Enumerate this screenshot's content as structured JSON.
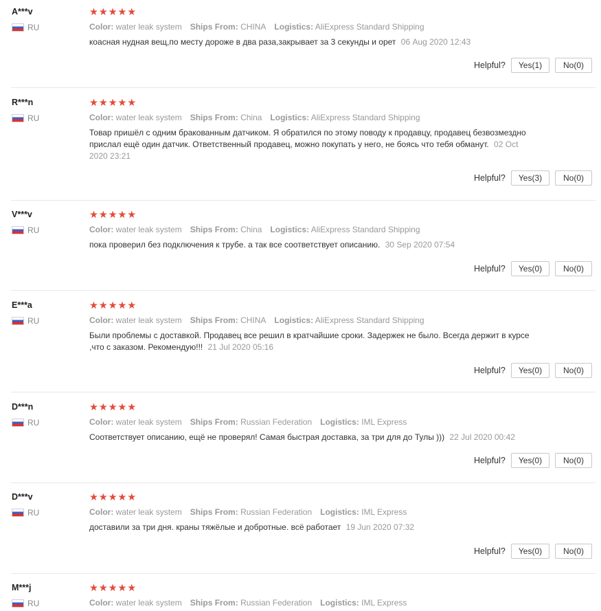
{
  "labels": {
    "color": "Color:",
    "ships_from": "Ships From:",
    "logistics": "Logistics:",
    "helpful": "Helpful?",
    "yes": "Yes",
    "no": "No",
    "stars": "★★★★★"
  },
  "colors": {
    "star": "#e34b3b",
    "meta_gray": "#999999",
    "flag_ru": [
      "#ffffff",
      "#3a5fc8",
      "#e0312b"
    ]
  },
  "reviews": [
    {
      "user": "A***v",
      "country": "RU",
      "rating": 5,
      "color": "water leak system",
      "ships_from": "CHINA",
      "logistics": "AliExpress Standard Shipping",
      "content": "коасная нудная вещ,по месту дороже в два раза,закрывает за 3 секунды и орет",
      "date": "06 Aug 2020 12:43",
      "yes_count": "(1)",
      "no_count": "(0)"
    },
    {
      "user": "R***n",
      "country": "RU",
      "rating": 5,
      "color": "water leak system",
      "ships_from": "China",
      "logistics": "AliExpress Standard Shipping",
      "content": "Товар пришёл с одним бракованным датчиком. Я обратился по этому поводу к продавцу, продавец безвозмездно прислал ещё один датчик. Ответственный продавец, можно покупать у него, не боясь что тебя обманут.",
      "date": "02 Oct 2020 23:21",
      "yes_count": "(3)",
      "no_count": "(0)"
    },
    {
      "user": "V***v",
      "country": "RU",
      "rating": 5,
      "color": "water leak system",
      "ships_from": "China",
      "logistics": "AliExpress Standard Shipping",
      "content": "пока проверил без подключения к трубе. а так все соответствует описанию.",
      "date": "30 Sep 2020 07:54",
      "yes_count": "(0)",
      "no_count": "(0)"
    },
    {
      "user": "E***a",
      "country": "RU",
      "rating": 5,
      "color": "water leak system",
      "ships_from": "CHINA",
      "logistics": "AliExpress Standard Shipping",
      "content": "Были проблемы с доставкой. Продавец все решил в кратчайшие сроки. Задержек не было. Всегда держит в курсе ,что с заказом. Рекомендую!!!",
      "date": "21 Jul 2020 05:16",
      "yes_count": "(0)",
      "no_count": "(0)"
    },
    {
      "user": "D***n",
      "country": "RU",
      "rating": 5,
      "color": "water leak system",
      "ships_from": "Russian Federation",
      "logistics": "IML Express",
      "content": "Соответствует описанию, ещё не проверял! Самая быстрая доставка, за три для до Тулы )))",
      "date": "22 Jul 2020 00:42",
      "yes_count": "(0)",
      "no_count": "(0)"
    },
    {
      "user": "D***v",
      "country": "RU",
      "rating": 5,
      "color": "water leak system",
      "ships_from": "Russian Federation",
      "logistics": "IML Express",
      "content": "доставили за три дня. краны тяжёлые и добротные. всё работает",
      "date": "19 Jun 2020 07:32",
      "yes_count": "(0)",
      "no_count": "(0)"
    },
    {
      "user": "M***j",
      "country": "RU",
      "rating": 5,
      "color": "water leak system",
      "ships_from": "Russian Federation",
      "logistics": "IML Express",
      "content": "",
      "date": "",
      "yes_count": "",
      "no_count": ""
    }
  ]
}
